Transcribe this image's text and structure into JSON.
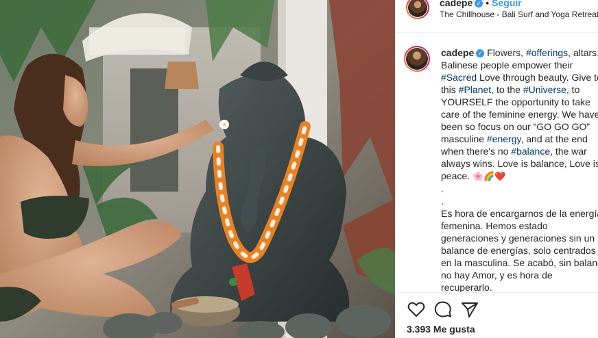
{
  "post": {
    "username": "cadepe",
    "verified_icon": "verified-badge-icon",
    "follow_label": "Seguir",
    "separator": "•",
    "location": "The Chillhouse - Bali Surf and Yoga Retreats",
    "caption": {
      "username": "cadepe",
      "segments": [
        {
          "text": " Flowers, ",
          "tag": false
        },
        {
          "text": "#offerings",
          "tag": true
        },
        {
          "text": ", altars...\nBalinese people empower their\n",
          "tag": false
        },
        {
          "text": "#Sacred",
          "tag": true
        },
        {
          "text": " Love through beauty. Give to\nthis ",
          "tag": false
        },
        {
          "text": "#Planet",
          "tag": true
        },
        {
          "text": ", to the ",
          "tag": false
        },
        {
          "text": "#Universe",
          "tag": true
        },
        {
          "text": ", to\nYOURSELF the opportunity to take\ncare of the feminine energy. We have\nbeen so focus on our “GO GO GO”\nmasculine ",
          "tag": false
        },
        {
          "text": "#energy",
          "tag": true
        },
        {
          "text": ", and at the end\nwhen there's no ",
          "tag": false
        },
        {
          "text": "#balance",
          "tag": true
        },
        {
          "text": ", the war\nalways wins. Love is balance, Love is\npeace. ",
          "tag": false
        },
        {
          "text": "🌸🌈❤️",
          "tag": false,
          "emoji": true
        },
        {
          "text": "\n.\n.\nEs hora de encargarnos de la energía\nfemenina. Hemos estado\ngeneraciones y generaciones sin un\nbalance de energías, solo centrados\nen la masculina. Se acabó, sin balance\nno hay Amor, y es hora de\nrecuperarlo.",
          "tag": false
        }
      ]
    },
    "actions": {
      "like_icon": "heart-icon",
      "comment_icon": "comment-icon",
      "share_icon": "share-icon"
    },
    "likes_text": "3.393 Me gusta"
  },
  "colors": {
    "link_blue": "#3897f0",
    "hashtag": "#00376b",
    "text": "#262626",
    "border": "#efefef"
  }
}
